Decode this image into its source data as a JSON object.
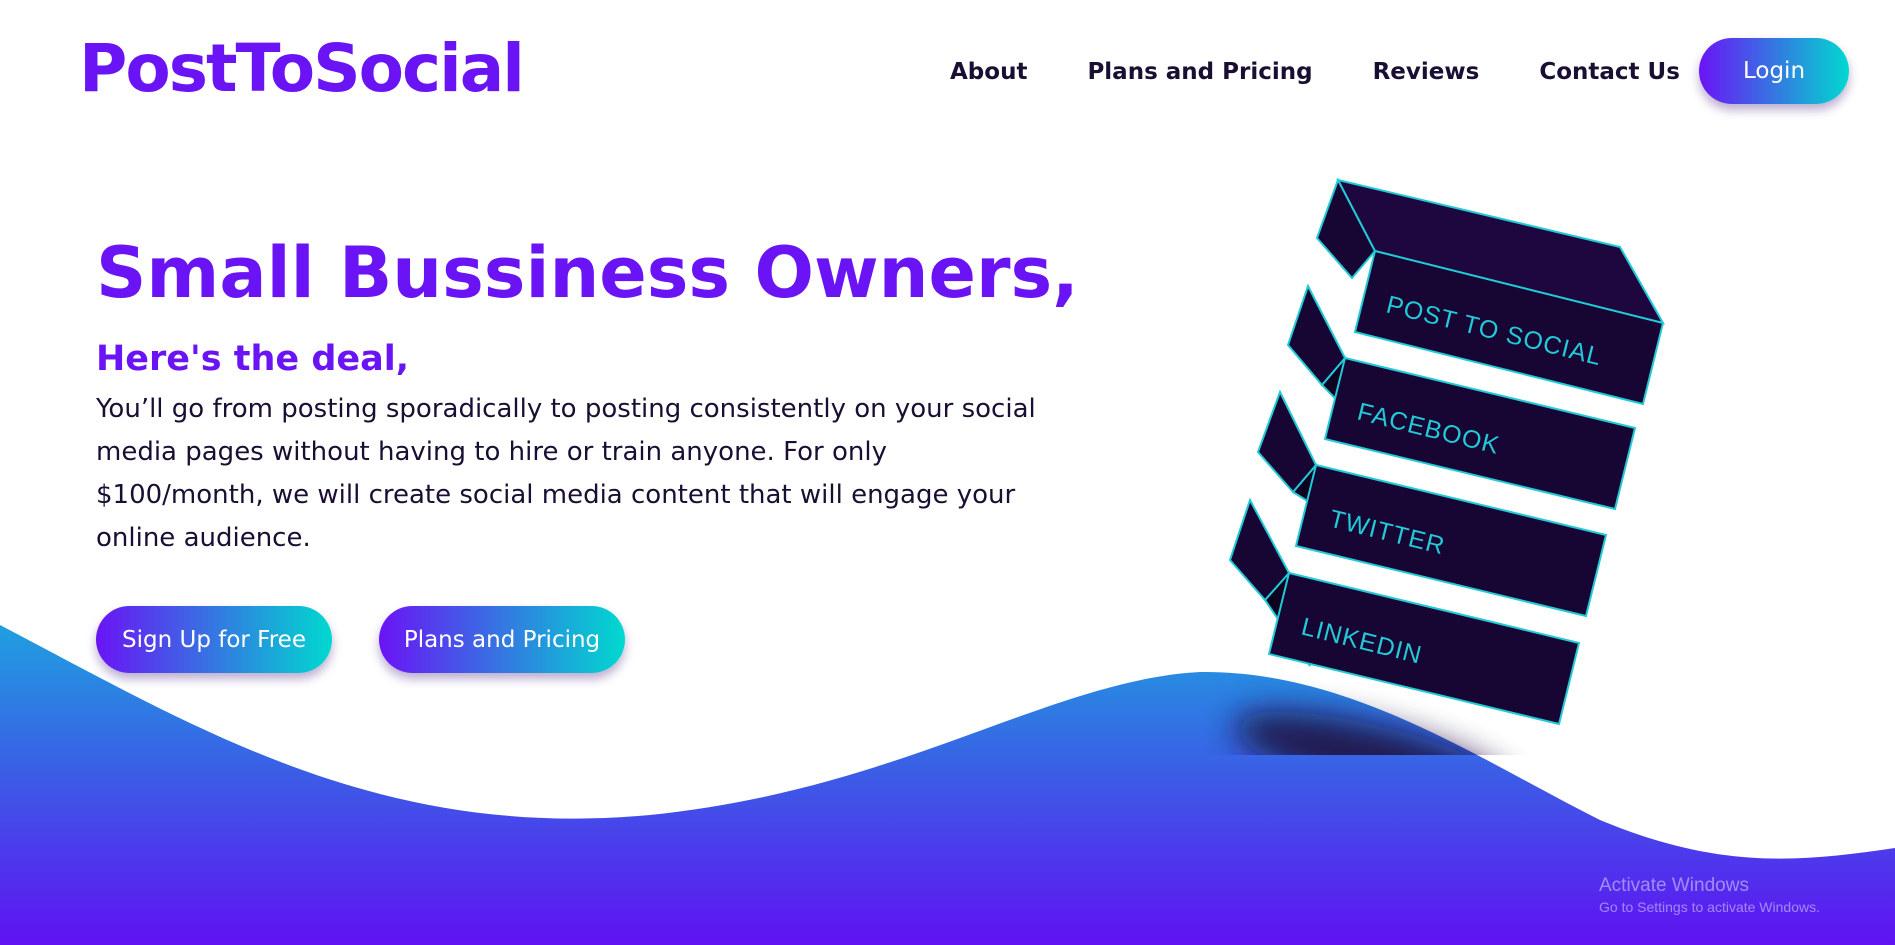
{
  "brand": {
    "logo_text": "PostToSocial"
  },
  "nav": {
    "links": [
      {
        "label": "About"
      },
      {
        "label": "Plans and Pricing"
      },
      {
        "label": "Reviews"
      },
      {
        "label": "Contact Us"
      }
    ],
    "login_label": "Login"
  },
  "hero": {
    "title": "Small Bussiness Owners,",
    "subtitle": "Here's the deal,",
    "body": "You’ll go from posting sporadically to posting consistently on your social media pages without having to hire or train anyone. For only $100/month, we will create social media content that will engage your online audience.",
    "cta_primary": "Sign Up for Free",
    "cta_secondary": "Plans and Pricing"
  },
  "illustration": {
    "blocks": [
      "POST TO SOCIAL",
      "FACEBOOK",
      "TWITTER",
      "LINKEDIN"
    ]
  },
  "watermark": {
    "title": "Activate Windows",
    "subtitle": "Go to Settings to activate Windows."
  },
  "colors": {
    "brand_purple": "#6a14f5",
    "accent_cyan": "#00d9cf",
    "text_dark": "#1a0f33",
    "block_fill": "#170533",
    "block_edge": "#22c9d6"
  }
}
